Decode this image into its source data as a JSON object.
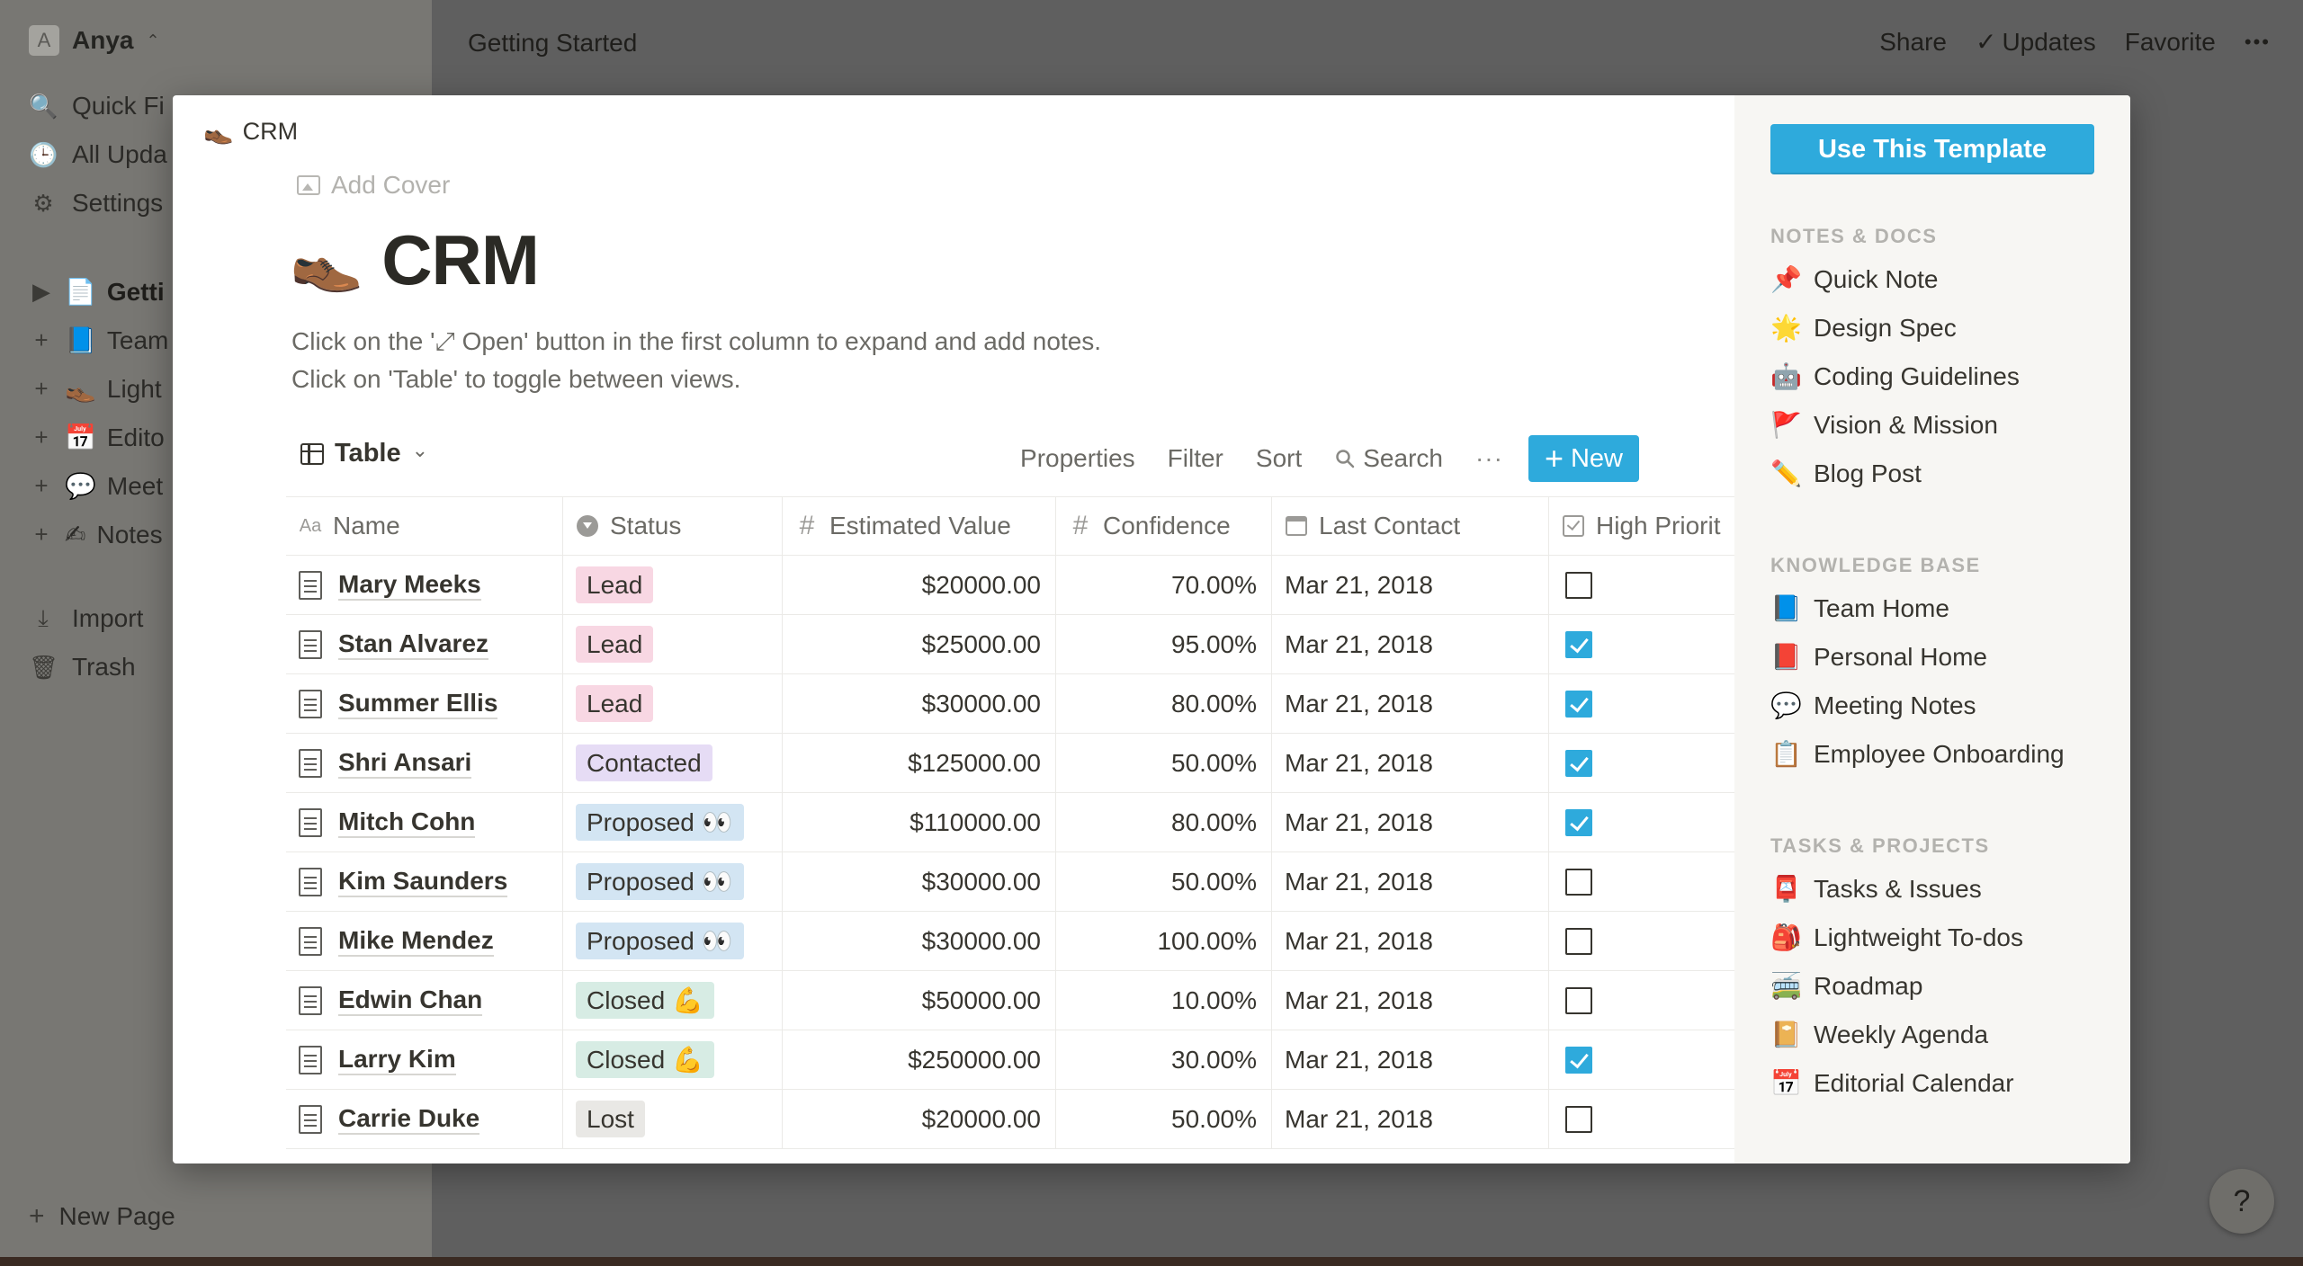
{
  "sidebar": {
    "workspace": {
      "avatar": "A",
      "name": "Anya",
      "caret": "⌃"
    },
    "nav": [
      {
        "icon": "search-icon",
        "glyph": "🔍",
        "label": "Quick Fi"
      },
      {
        "icon": "clock-icon",
        "glyph": "🕒",
        "label": "All Upda"
      },
      {
        "icon": "gear-icon",
        "glyph": "⚙",
        "label": "Settings"
      }
    ],
    "pages": [
      {
        "expander": "▶",
        "emoji": "📄",
        "label": "Getti",
        "active": true
      },
      {
        "expander": "+",
        "emoji": "📘",
        "label": "Team"
      },
      {
        "expander": "+",
        "emoji": "👞",
        "label": "Light"
      },
      {
        "expander": "+",
        "emoji": "📅",
        "label": "Edito"
      },
      {
        "expander": "+",
        "emoji": "💬",
        "label": "Meet"
      },
      {
        "expander": "+",
        "emoji": "✍",
        "label": "Notes"
      }
    ],
    "extras": [
      {
        "icon": "import-icon",
        "glyph": "⤓",
        "label": "Import"
      },
      {
        "icon": "trash-icon",
        "glyph": "🗑",
        "label": "Trash"
      }
    ],
    "new_page": "New Page"
  },
  "topbar": {
    "breadcrumb": "Getting Started",
    "share": "Share",
    "updates_check": "✓",
    "updates": "Updates",
    "favorite": "Favorite",
    "more": "•••"
  },
  "help": "?",
  "preview": {
    "breadcrumb_emoji": "👞",
    "breadcrumb": "CRM",
    "add_cover": "Add Cover",
    "title_emoji": "👞",
    "title": "CRM",
    "description": [
      "Click on the '⤢ Open' button in the first column to expand and add notes.",
      "Click on 'Table' to toggle between views."
    ],
    "toolbar": {
      "view": "Table",
      "view_caret": "⌄",
      "properties": "Properties",
      "filter": "Filter",
      "sort": "Sort",
      "search": "Search",
      "more": "···",
      "new": "New"
    },
    "columns": {
      "name": {
        "icon": "Aa",
        "label": "Name"
      },
      "status": {
        "label": "Status"
      },
      "value": {
        "icon": "#",
        "label": "Estimated Value"
      },
      "confidence": {
        "icon": "#",
        "label": "Confidence"
      },
      "last_contact": {
        "label": "Last Contact"
      },
      "priority": {
        "label": "High Priorit"
      }
    },
    "rows": [
      {
        "name": "Mary Meeks",
        "status": "Lead",
        "status_class": "lead",
        "value": "$20000.00",
        "confidence": "70.00%",
        "date": "Mar 21, 2018",
        "priority": false
      },
      {
        "name": "Stan Alvarez",
        "status": "Lead",
        "status_class": "lead",
        "value": "$25000.00",
        "confidence": "95.00%",
        "date": "Mar 21, 2018",
        "priority": true
      },
      {
        "name": "Summer Ellis",
        "status": "Lead",
        "status_class": "lead",
        "value": "$30000.00",
        "confidence": "80.00%",
        "date": "Mar 21, 2018",
        "priority": true
      },
      {
        "name": "Shri Ansari",
        "status": "Contacted",
        "status_class": "contacted",
        "value": "$125000.00",
        "confidence": "50.00%",
        "date": "Mar 21, 2018",
        "priority": true
      },
      {
        "name": "Mitch Cohn",
        "status": "Proposed 👀",
        "status_class": "proposed",
        "value": "$110000.00",
        "confidence": "80.00%",
        "date": "Mar 21, 2018",
        "priority": true
      },
      {
        "name": "Kim Saunders",
        "status": "Proposed 👀",
        "status_class": "proposed",
        "value": "$30000.00",
        "confidence": "50.00%",
        "date": "Mar 21, 2018",
        "priority": false
      },
      {
        "name": "Mike Mendez",
        "status": "Proposed 👀",
        "status_class": "proposed",
        "value": "$30000.00",
        "confidence": "100.00%",
        "date": "Mar 21, 2018",
        "priority": false
      },
      {
        "name": "Edwin Chan",
        "status": "Closed 💪",
        "status_class": "closed",
        "value": "$50000.00",
        "confidence": "10.00%",
        "date": "Mar 21, 2018",
        "priority": false
      },
      {
        "name": "Larry Kim",
        "status": "Closed 💪",
        "status_class": "closed",
        "value": "$250000.00",
        "confidence": "30.00%",
        "date": "Mar 21, 2018",
        "priority": true
      },
      {
        "name": "Carrie Duke",
        "status": "Lost",
        "status_class": "lost",
        "value": "$20000.00",
        "confidence": "50.00%",
        "date": "Mar 21, 2018",
        "priority": false
      }
    ]
  },
  "template_panel": {
    "use_button": "Use This Template",
    "sections": [
      {
        "heading": "NOTES & DOCS",
        "items": [
          {
            "emoji": "📌",
            "label": "Quick Note"
          },
          {
            "emoji": "🌟",
            "label": "Design Spec"
          },
          {
            "emoji": "🤖",
            "label": "Coding Guidelines"
          },
          {
            "emoji": "🚩",
            "label": "Vision & Mission"
          },
          {
            "emoji": "✏️",
            "label": "Blog Post"
          }
        ]
      },
      {
        "heading": "KNOWLEDGE BASE",
        "items": [
          {
            "emoji": "📘",
            "label": "Team Home"
          },
          {
            "emoji": "📕",
            "label": "Personal Home"
          },
          {
            "emoji": "💬",
            "label": "Meeting Notes"
          },
          {
            "emoji": "📋",
            "label": "Employee Onboarding"
          }
        ]
      },
      {
        "heading": "TASKS & PROJECTS",
        "items": [
          {
            "emoji": "📮",
            "label": "Tasks & Issues"
          },
          {
            "emoji": "🎒",
            "label": "Lightweight To-dos"
          },
          {
            "emoji": "🚎",
            "label": "Roadmap"
          },
          {
            "emoji": "📔",
            "label": "Weekly Agenda"
          },
          {
            "emoji": "📅",
            "label": "Editorial Calendar"
          }
        ]
      }
    ]
  }
}
